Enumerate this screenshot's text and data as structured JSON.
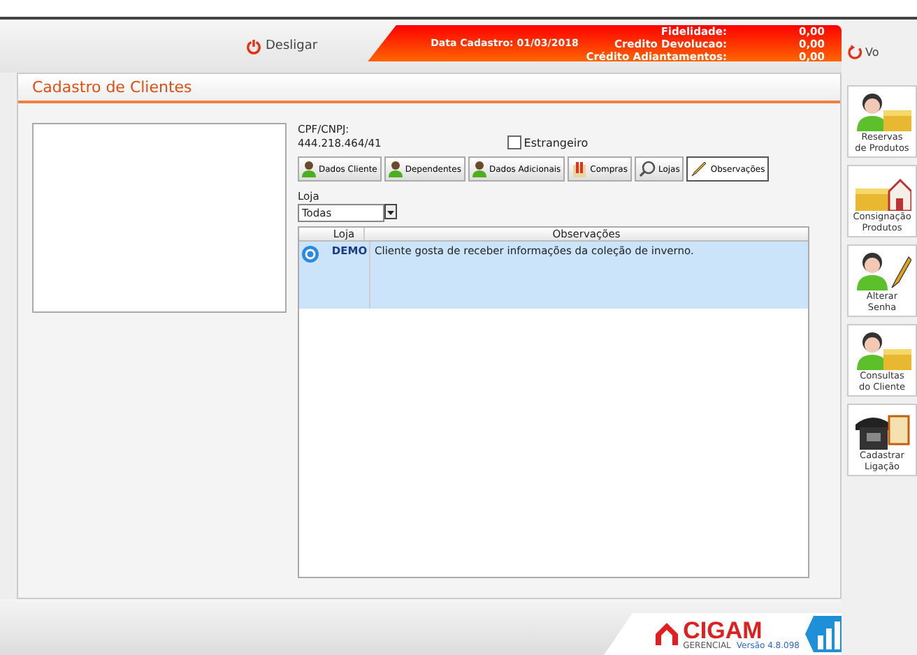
{
  "header": {
    "logout_label": "Desligar",
    "register_date": "Data Cadastro: 01/03/2018",
    "balances": [
      {
        "label": "Fidelidade:",
        "value": "0,00"
      },
      {
        "label": "Credito Devolucao:",
        "value": "0,00"
      },
      {
        "label": "Crédito Adiantamentos:",
        "value": "0,00"
      }
    ],
    "back_label": "Vo"
  },
  "panel": {
    "title": "Cadastro de Clientes",
    "cpf_label": "CPF/CNPJ:",
    "cpf_value": "444.218.464/41",
    "foreigner": {
      "label": "Estrangeiro",
      "checked": false
    },
    "tabs": [
      {
        "label": "Dados Cliente",
        "kind": "person",
        "selected": false
      },
      {
        "label": "Dependentes",
        "kind": "person",
        "selected": false
      },
      {
        "label": "Dados Adicionais",
        "kind": "person",
        "selected": false
      },
      {
        "label": "Compras",
        "kind": "bag",
        "selected": false
      },
      {
        "label": "Lojas",
        "kind": "search",
        "selected": false
      },
      {
        "label": "Observações",
        "kind": "pencil",
        "selected": true
      }
    ],
    "store_filter": {
      "label": "Loja",
      "value": "Todas"
    },
    "table": {
      "columns": [
        "Loja",
        "Observações"
      ],
      "rows": [
        {
          "store": "DEMO",
          "note": "Cliente gosta de receber informações da coleção de inverno.",
          "selected": true
        }
      ]
    }
  },
  "sidebar": [
    {
      "label": "Reservas de Produtos",
      "kind": "person-box"
    },
    {
      "label": "Consignação Produtos",
      "kind": "box-house"
    },
    {
      "label": "Alterar Senha",
      "kind": "person-pencil"
    },
    {
      "label": "Consultas do Cliente",
      "kind": "person-box"
    },
    {
      "label": "Cadastrar Ligação",
      "kind": "phone"
    }
  ],
  "footer": {
    "brand": "CIGAM",
    "edition": "GERENCIAL",
    "version": "Versão 4.8.098"
  }
}
